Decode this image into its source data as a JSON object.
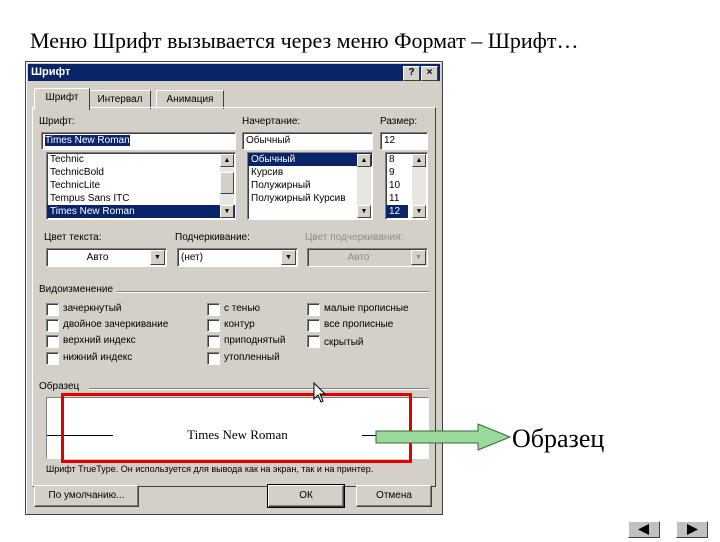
{
  "slide": {
    "title": "Меню Шрифт вызывается через меню Формат – Шрифт…",
    "callout_label": "Образец"
  },
  "dialog": {
    "title": "Шрифт",
    "help_btn": "?",
    "close_btn": "×",
    "tabs": [
      "Шрифт",
      "Интервал",
      "Анимация"
    ],
    "font": {
      "label": "Шрифт:",
      "value": "Times New Roman",
      "items": [
        "Technic",
        "TechnicBold",
        "TechnicLite",
        "Tempus Sans ITC",
        "Times New Roman"
      ]
    },
    "style": {
      "label": "Начертание:",
      "value": "Обычный",
      "items": [
        "Обычный",
        "Курсив",
        "Полужирный",
        "Полужирный Курсив"
      ]
    },
    "size": {
      "label": "Размер:",
      "value": "12",
      "items": [
        "8",
        "9",
        "10",
        "11",
        "12"
      ]
    },
    "color": {
      "label": "Цвет текста:",
      "value": "Авто"
    },
    "underline": {
      "label": "Подчеркивание:",
      "value": "(нет)"
    },
    "underline_color": {
      "label": "Цвет подчеркивания:",
      "value": "Авто"
    },
    "effects": {
      "label": "Видоизменение",
      "col1": [
        "зачеркнутый",
        "двойное зачеркивание",
        "верхний индекс",
        "нижний индекс"
      ],
      "col2": [
        "с тенью",
        "контур",
        "приподнятый",
        "утопленный"
      ],
      "col3": [
        "малые прописные",
        "все прописные",
        "скрытый"
      ]
    },
    "preview": {
      "label": "Образец",
      "sample": "Times New Roman",
      "note": "Шрифт TrueType. Он используется для вывода как на экран, так и на принтер."
    },
    "buttons": {
      "default": "По умолчанию...",
      "ok": "ОК",
      "cancel": "Отмена"
    }
  },
  "colors": {
    "titlebar": "#0a246a",
    "selection": "#0a246a",
    "frame": "#e00000",
    "arrow": "#9bd89b"
  },
  "icons": [
    "help-icon",
    "close-icon",
    "scroll-up-icon",
    "scroll-down-icon",
    "dropdown-arrow-icon",
    "mouse-cursor-icon",
    "arrow-right-icon",
    "nav-prev-icon",
    "nav-next-icon"
  ]
}
